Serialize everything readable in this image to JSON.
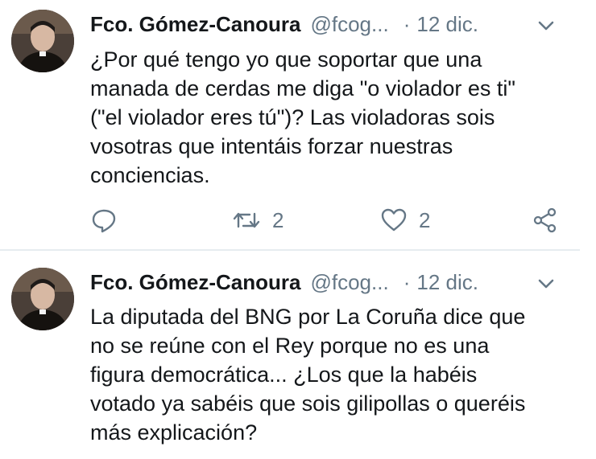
{
  "tweets": [
    {
      "author_name": "Fco. Gómez-Canoura",
      "handle": "@fcog...",
      "separator": "·",
      "date": "12 dic.",
      "text": "¿Por qué tengo yo que soportar que una\nmanada de cerdas me diga \"o violador es ti\"\n(\"el violador eres tú\")? Las violadoras sois\nvosotras que intentáis forzar nuestras\nconciencias.",
      "retweets": "2",
      "likes": "2",
      "icons": {
        "menu": "chevron-down-icon",
        "reply": "reply-icon",
        "retweet": "retweet-icon",
        "like": "heart-icon",
        "share": "share-icon"
      }
    },
    {
      "author_name": "Fco. Gómez-Canoura",
      "handle": "@fcog...",
      "separator": "·",
      "date": "12 dic.",
      "text": "La diputada del BNG por La Coruña dice que\nno se reúne con el Rey porque no es una\nfigura democrática... ¿Los que la habéis\nvotado ya sabéis que sois gilipollas o queréis\nmás explicación?",
      "icons": {
        "menu": "chevron-down-icon"
      }
    }
  ],
  "colors": {
    "text": "#14171a",
    "secondary": "#657786",
    "divider": "#e6ecf0"
  }
}
